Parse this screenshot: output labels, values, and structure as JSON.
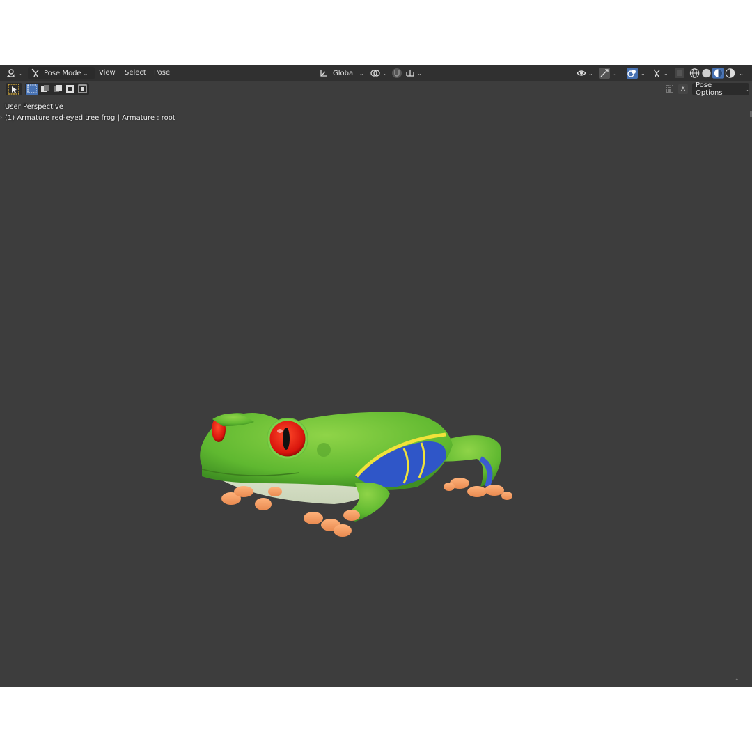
{
  "header": {
    "mode_label": "Pose Mode",
    "menus": [
      "View",
      "Select",
      "Pose"
    ],
    "orientation_label": "Global"
  },
  "tool_header": {
    "pose_options_label": "Pose Options",
    "x_label": "X"
  },
  "viewport": {
    "perspective_label": "User Perspective",
    "object_info": "(1) Armature red-eyed tree frog | Armature : root"
  },
  "colors": {
    "viewport_bg": "#3d3d3d",
    "header_bg": "#303030",
    "accent_blue": "#4772b3"
  },
  "icons": [
    "editor-type-icon",
    "pose-mode-icon",
    "transform-orientation-icon",
    "pivot-icon",
    "snap-icon",
    "proportional-icon",
    "visibility-icon",
    "gizmo-icon",
    "overlay-icon",
    "xray-icon",
    "wireframe-shading-icon",
    "solid-shading-icon",
    "material-shading-icon",
    "rendered-shading-icon",
    "select-box-tool-icon",
    "mirror-icon"
  ]
}
